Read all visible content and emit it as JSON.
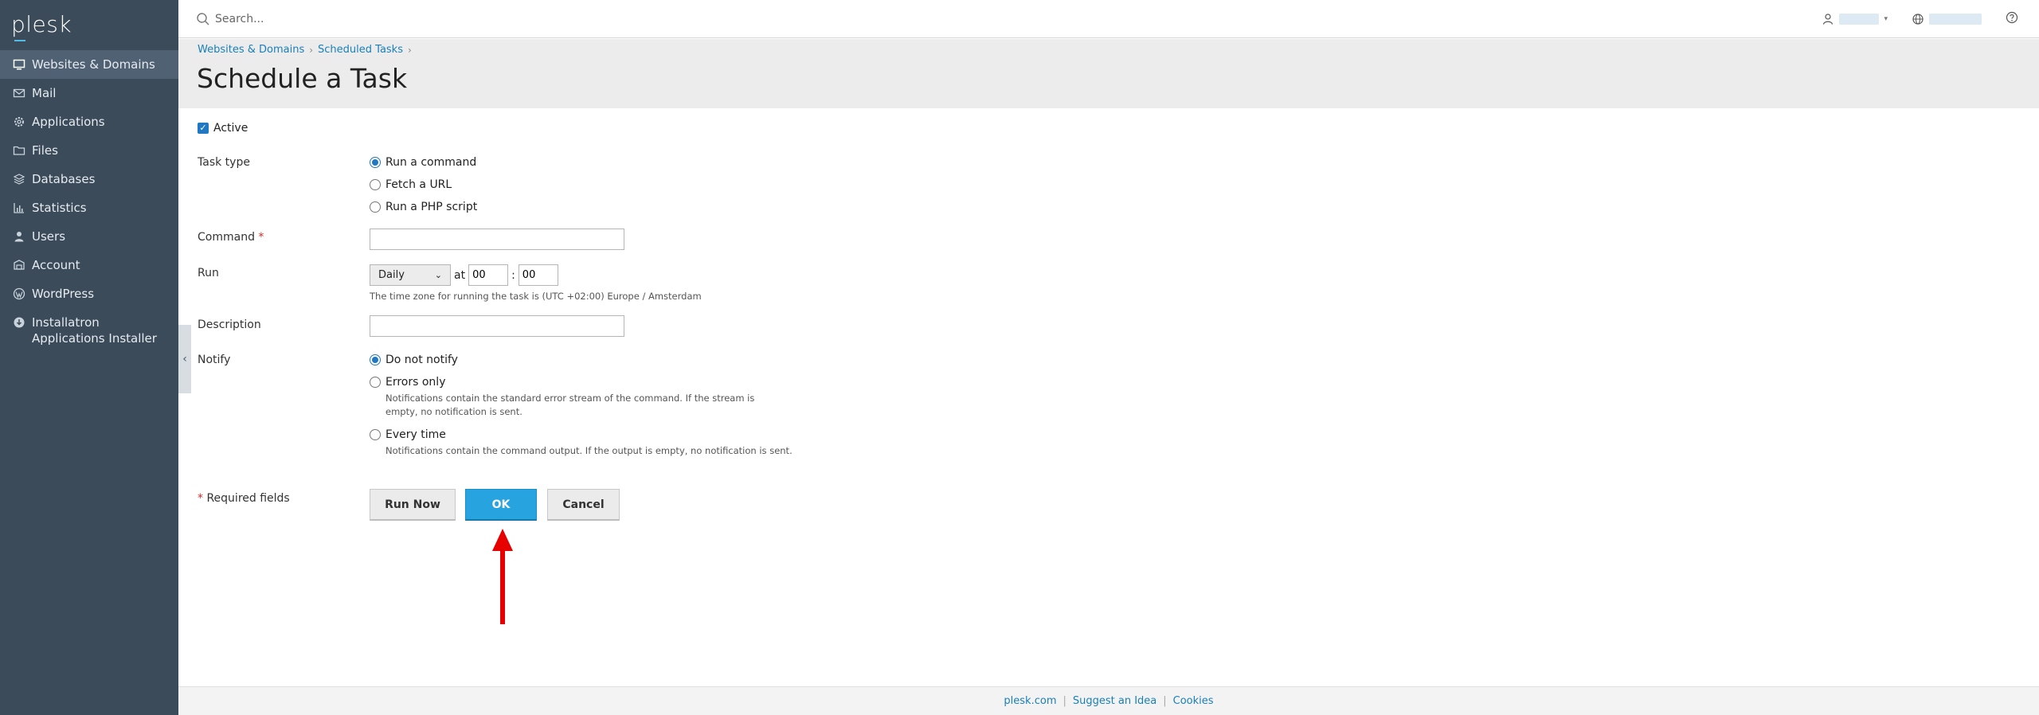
{
  "app": {
    "logo": "plesk"
  },
  "sidebar": {
    "items": [
      {
        "label": "Websites & Domains",
        "icon": "monitor-icon",
        "active": true
      },
      {
        "label": "Mail",
        "icon": "mail-icon"
      },
      {
        "label": "Applications",
        "icon": "gear-icon"
      },
      {
        "label": "Files",
        "icon": "folder-icon"
      },
      {
        "label": "Databases",
        "icon": "database-icon"
      },
      {
        "label": "Statistics",
        "icon": "bar-chart-icon"
      },
      {
        "label": "Users",
        "icon": "user-icon"
      },
      {
        "label": "Account",
        "icon": "account-icon"
      },
      {
        "label": "WordPress",
        "icon": "wordpress-icon"
      },
      {
        "label": "Installatron Applications Installer",
        "icon": "installatron-icon"
      }
    ]
  },
  "header": {
    "search_placeholder": "Search..."
  },
  "breadcrumb": {
    "items": [
      "Websites & Domains",
      "Scheduled Tasks"
    ]
  },
  "page": {
    "title": "Schedule a Task"
  },
  "form": {
    "active_label": "Active",
    "task_type_label": "Task type",
    "task_types": [
      "Run a command",
      "Fetch a URL",
      "Run a PHP script"
    ],
    "command_label": "Command",
    "required_mark": "*",
    "run_label": "Run",
    "run_frequency": "Daily",
    "at_label": "at",
    "hour": "00",
    "colon": ":",
    "minute": "00",
    "timezone_hint": "The time zone for running the task is (UTC +02:00) Europe / Amsterdam",
    "description_label": "Description",
    "notify_label": "Notify",
    "notify_options": [
      "Do not notify",
      "Errors only",
      "Every time"
    ],
    "errors_hint": "Notifications contain the standard error stream of the command. If the stream is empty, no notification is sent.",
    "every_hint": "Notifications contain the command output. If the output is empty, no notification is sent.",
    "required_fields": "Required fields"
  },
  "buttons": {
    "run_now": "Run Now",
    "ok": "OK",
    "cancel": "Cancel"
  },
  "footer": {
    "links": [
      "plesk.com",
      "Suggest an Idea",
      "Cookies"
    ]
  },
  "colors": {
    "sidebar": "#3b4b5a",
    "primary": "#27a4e0",
    "arrow": "#e60000",
    "link": "#1a7fb8"
  }
}
